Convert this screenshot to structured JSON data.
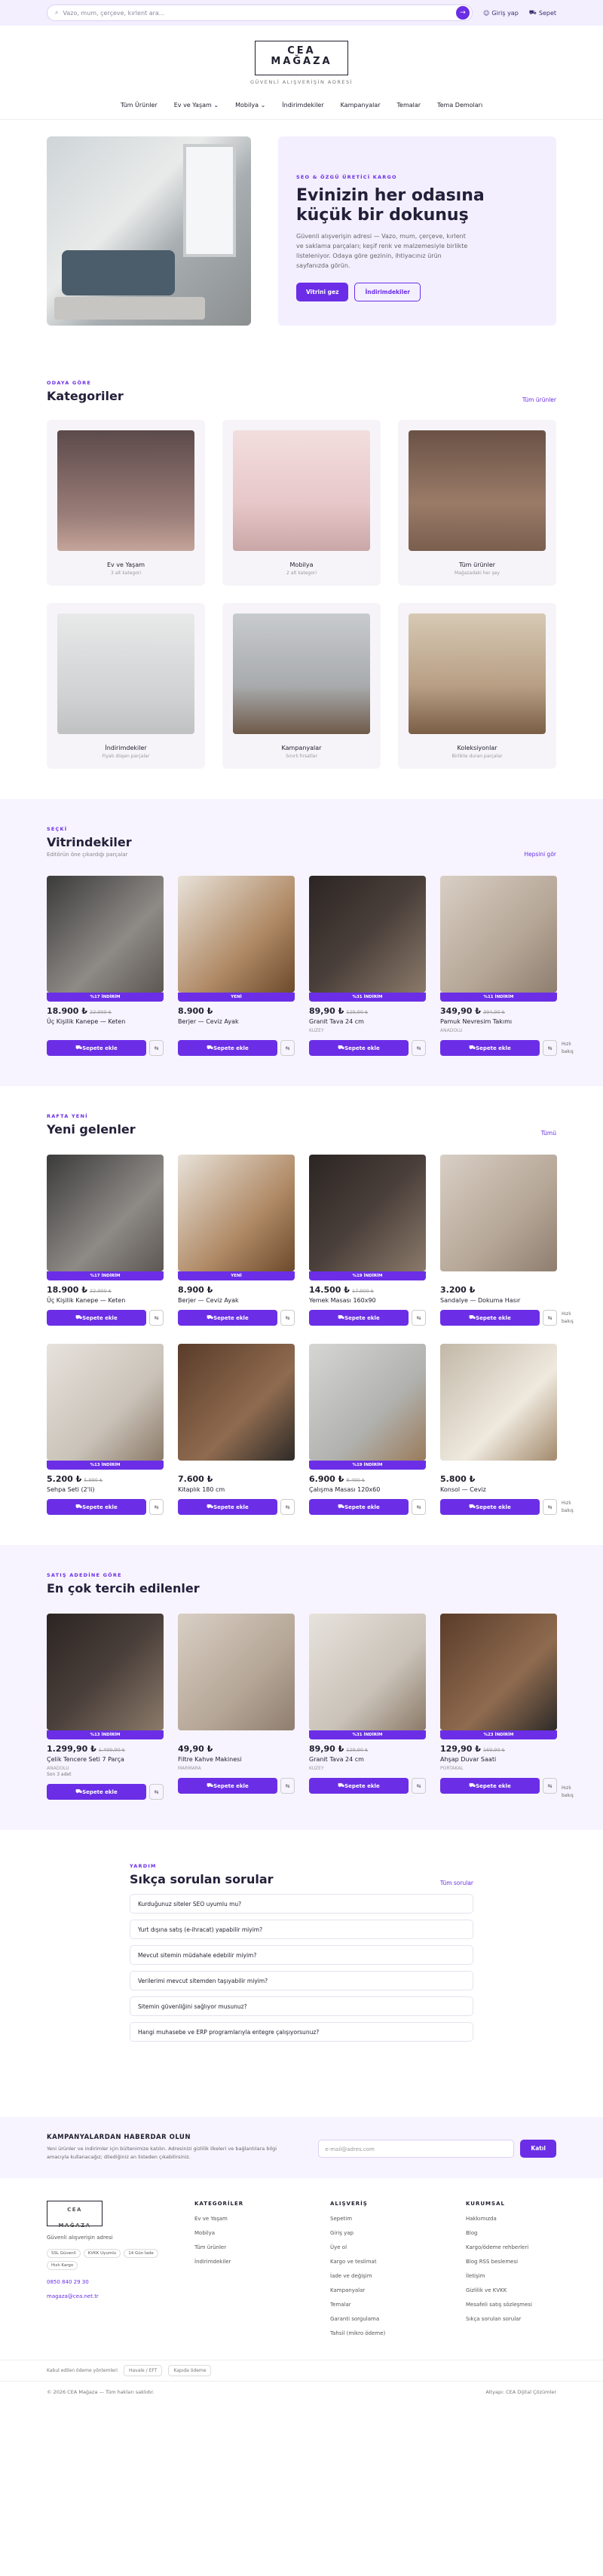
{
  "topbar": {
    "search_placeholder": "Vazo, mum, çerçeve, kırlent ara...",
    "login": "Giriş yap",
    "cart": "Sepet"
  },
  "brand": {
    "logo_line1": "CEA",
    "logo_line2": "MAĞAZA",
    "tagline": "GÜVENLİ ALIŞVERİŞİN ADRESİ"
  },
  "nav": [
    "Tüm Ürünler",
    "Ev ve Yaşam",
    "Mobilya",
    "İndirimdekiler",
    "Kampanyalar",
    "Temalar",
    "Tema Demoları"
  ],
  "hero": {
    "eyebrow": "SEO & ÖZGÜ ÜRETİCİ KARGO",
    "title": "Evinizin her odasına küçük bir dokunuş",
    "text": "Güvenli alışverişin adresi — Vazo, mum, çerçeve, kırlent ve saklama parçaları; keşif renk ve malzemesiyle birlikte listeleniyor. Odaya göre gezinin, ihtiyacınız ürün sayfanızda görün.",
    "btn_primary": "Vitrini gez",
    "btn_secondary": "İndirimdekiler"
  },
  "categories": {
    "eyebrow": "ODAYA GÖRE",
    "title": "Kategoriler",
    "link": "Tüm ürünler",
    "items": [
      {
        "name": "Ev ve Yaşam",
        "sub": "3 alt kategori"
      },
      {
        "name": "Mobilya",
        "sub": "2 alt kategori"
      },
      {
        "name": "Tüm ürünler",
        "sub": "Mağazadaki her şey"
      },
      {
        "name": "İndirimdekiler",
        "sub": "Fiyatı düşen parçalar"
      },
      {
        "name": "Kampanyalar",
        "sub": "Sınırlı fırsatlar"
      },
      {
        "name": "Koleksiyonlar",
        "sub": "Birlikte duran parçalar"
      }
    ]
  },
  "showcase": {
    "eyebrow": "SEÇKİ",
    "title": "Vitrindekiler",
    "sub": "Editörün öne çıkardığı parçalar",
    "link": "Hepsini gör",
    "items": [
      {
        "band": "%17 İNDİRİM",
        "price": "18.900 ₺",
        "old": "22.900 ₺",
        "name": "Üç Kişilik Kanepe — Keten",
        "brand": "",
        "stock": ""
      },
      {
        "band": "YENİ",
        "price": "8.900 ₺",
        "old": "",
        "name": "Berjer — Ceviz Ayak",
        "brand": "",
        "stock": ""
      },
      {
        "band": "%31 İNDİRİM",
        "price": "89,90 ₺",
        "old": "129,90 ₺",
        "name": "Granit Tava 24 cm",
        "brand": "KUZEY",
        "stock": ""
      },
      {
        "band": "%11 İNDİRİM",
        "price": "349,90 ₺",
        "old": "394,90 ₺",
        "name": "Pamuk Nevresim Takımı",
        "brand": "ANADOLU",
        "stock": ""
      }
    ]
  },
  "newest": {
    "eyebrow": "RAFTA YENİ",
    "title": "Yeni gelenler",
    "link": "Tümü",
    "items": [
      {
        "band": "%17 İNDİRİM",
        "price": "18.900 ₺",
        "old": "22.900 ₺",
        "name": "Üç Kişilik Kanepe — Keten"
      },
      {
        "band": "YENİ",
        "price": "8.900 ₺",
        "old": "",
        "name": "Berjer — Ceviz Ayak"
      },
      {
        "band": "%19 İNDİRİM",
        "price": "14.500 ₺",
        "old": "17.900 ₺",
        "name": "Yemek Masası 160x90"
      },
      {
        "band": "",
        "price": "3.200 ₺",
        "old": "",
        "name": "Sandalye — Dokuma Hasır"
      },
      {
        "band": "%13 İNDİRİM",
        "price": "5.200 ₺",
        "old": "5.990 ₺",
        "name": "Sehpa Seti (2'li)"
      },
      {
        "band": "",
        "price": "7.600 ₺",
        "old": "",
        "name": "Kitaplık 180 cm"
      },
      {
        "band": "%19 İNDİRİM",
        "price": "6.900 ₺",
        "old": "8.490 ₺",
        "name": "Çalışma Masası 120x60"
      },
      {
        "band": "",
        "price": "5.800 ₺",
        "old": "",
        "name": "Konsol — Ceviz"
      }
    ]
  },
  "best": {
    "eyebrow": "SATIŞ ADEDİNE GÖRE",
    "title": "En çok tercih edilenler",
    "items": [
      {
        "band": "%13 İNDİRİM",
        "price": "1.299,90 ₺",
        "old": "1.499,90 ₺",
        "name": "Çelik Tencere Seti 7 Parça",
        "brand": "ANADOLU",
        "stock": "Son 3 adet"
      },
      {
        "band": "",
        "price": "49,90 ₺",
        "old": "",
        "name": "Filtre Kahve Makinesi",
        "brand": "MARMARA",
        "stock": ""
      },
      {
        "band": "%31 İNDİRİM",
        "price": "89,90 ₺",
        "old": "129,90 ₺",
        "name": "Granit Tava 24 cm",
        "brand": "KUZEY",
        "stock": ""
      },
      {
        "band": "%23 İNDİRİM",
        "price": "129,90 ₺",
        "old": "169,90 ₺",
        "name": "Ahşap Duvar Saati",
        "brand": "PORTAKAL",
        "stock": ""
      }
    ]
  },
  "product_actions": {
    "add": "Sepete ekle",
    "compare": "⇆",
    "side": "Hızlı bakış"
  },
  "faq": {
    "eyebrow": "YARDIM",
    "title": "Sıkça sorulan sorular",
    "link": "Tüm sorular",
    "items": [
      "Kurduğunuz siteler SEO uyumlu mu?",
      "Yurt dışına satış (e-ihracat) yapabilir miyim?",
      "Mevcut sitemin müdahale edebilir miyim?",
      "Verilerimi mevcut sitemden taşıyabilir miyim?",
      "Sitemin güvenliğini sağlıyor musunuz?",
      "Hangi muhasebe ve ERP programlarıyla entegre çalışıyorsunuz?"
    ]
  },
  "newsletter": {
    "title": "KAMPANYALARDAN HABERDAR OLUN",
    "text": "Yeni ürünler ve indirimler için bültenimize katılın. Adresinizi gizlilik ilkeleri ve bağlantılara bilgi amacıyla kullanacağız; dilediğiniz an listeden çıkabilirsiniz.",
    "placeholder": "e-mail@adres.com",
    "button": "Katıl"
  },
  "footer": {
    "brand_text": "Güvenli alışverişin adresi",
    "chips": [
      "SSL Güvenli",
      "KVKK Uyumlu",
      "14 Gün İade",
      "Hızlı Kargo"
    ],
    "phone": "0850 840 29 30",
    "email": "magaza@cea.net.tr",
    "cols": [
      {
        "title": "KATEGORİLER",
        "items": [
          "Ev ve Yaşam",
          "Mobilya",
          "Tüm ürünler",
          "İndirimdekiler"
        ]
      },
      {
        "title": "ALIŞVERİŞ",
        "items": [
          "Sepetim",
          "Giriş yap",
          "Üye ol",
          "Kargo ve teslimat",
          "İade ve değişim",
          "Kampanyalar",
          "Temalar",
          "Garanti sorgulama",
          "Tahsil (mikro ödeme)"
        ]
      },
      {
        "title": "KURUMSAL",
        "items": [
          "Hakkımızda",
          "Blog",
          "Kargo/ödeme rehberleri",
          "Blog RSS beslemesi",
          "İletişim",
          "Gizlilik ve KVKK",
          "Mesafeli satış sözleşmesi",
          "Sıkça sorulan sorular"
        ]
      }
    ]
  },
  "bottom": {
    "secure": "Kabul edilen ödeme yöntemleri",
    "b1": "Havale / EFT",
    "b2": "Kapıda ödeme",
    "copy": "© 2026 CEA Mağaza — Tüm hakları saklıdır.",
    "credit": "Altyapı: CEA Dijital Çözümler"
  }
}
